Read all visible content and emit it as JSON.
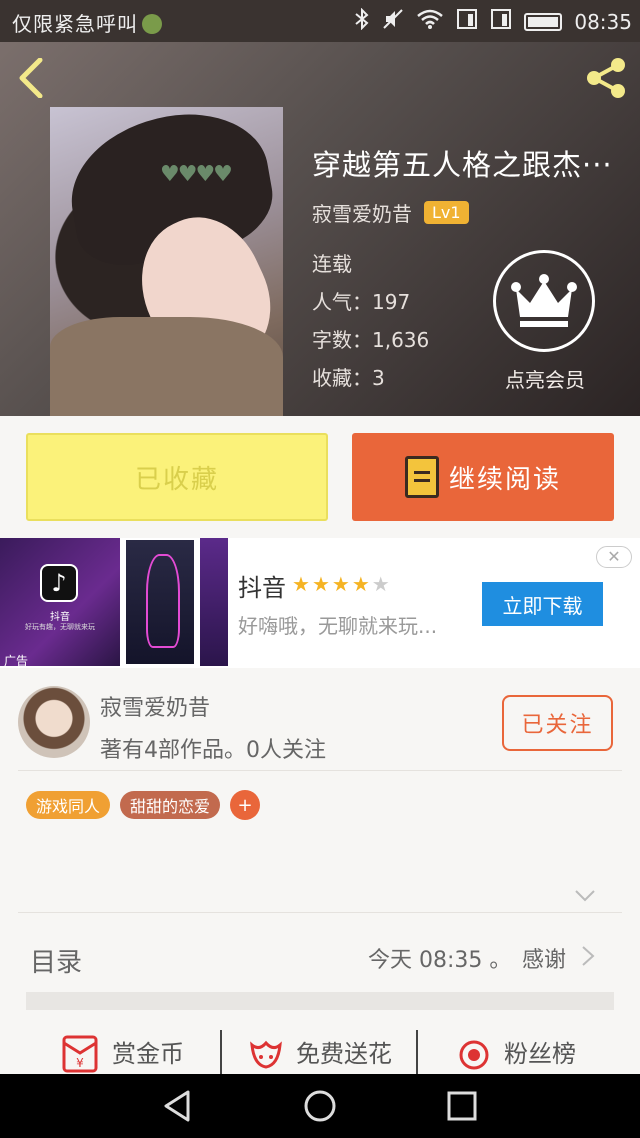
{
  "status_bar": {
    "carrier_text": "仅限紧急呼叫",
    "time": "08:35"
  },
  "book": {
    "title": "穿越第五人格之跟杰···",
    "author": "寂雪爱奶昔",
    "level": "Lv1",
    "status": "连载",
    "popularity": "人气：197",
    "word_count": "字数：1,636",
    "favorites": "收藏：3",
    "vip_label": "点亮会员"
  },
  "buttons": {
    "collected": "已收藏",
    "continue_reading": "继续阅读"
  },
  "ad": {
    "tag": "广告",
    "image_logo_text": "抖音",
    "image_subtext": "好玩有趣，无聊就来玩",
    "app_name": "抖音",
    "rating": 4,
    "rating_max": 5,
    "description": "好嗨哦，无聊就来玩...",
    "download_label": "立即下载",
    "close_icon": "close-icon"
  },
  "author_card": {
    "name": "寂雪爱奶昔",
    "works": "著有4部作品。0人关注",
    "follow_label": "已关注"
  },
  "tags": [
    {
      "label": "游戏同人",
      "color": "#f0a033"
    },
    {
      "label": "甜甜的恋爱",
      "color": "#c26a4e"
    }
  ],
  "toc": {
    "label": "目录",
    "updated": "今天 08:35",
    "separator": "。",
    "thanks": "感谢"
  },
  "actions": [
    {
      "label": "赏金币",
      "icon": "red-envelope-icon"
    },
    {
      "label": "免费送花",
      "icon": "flower-icon"
    },
    {
      "label": "粉丝榜",
      "icon": "medal-icon"
    }
  ],
  "colors": {
    "accent_orange": "#e9663a",
    "collected_yellow": "#fbf27a",
    "download_blue": "#1f8ee0",
    "level_badge": "#f0b233"
  }
}
